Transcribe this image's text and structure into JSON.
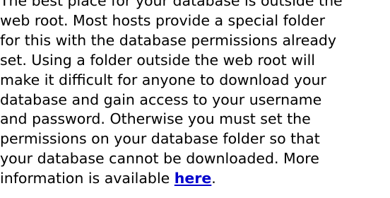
{
  "document": {
    "lines": [
      "The best place for your database is outside the",
      "web root. Most hosts provide a special folder",
      "for this with the database permissions already",
      "set. Using a folder outside the web root will",
      "make it difficult for anyone to download your",
      "database and gain access to your username",
      "and password. Otherwise you must set the",
      "permissions on your database folder so that",
      "your database cannot be downloaded. More"
    ],
    "last_line_prefix": "information is available ",
    "link_text": "here",
    "last_line_suffix": "."
  }
}
